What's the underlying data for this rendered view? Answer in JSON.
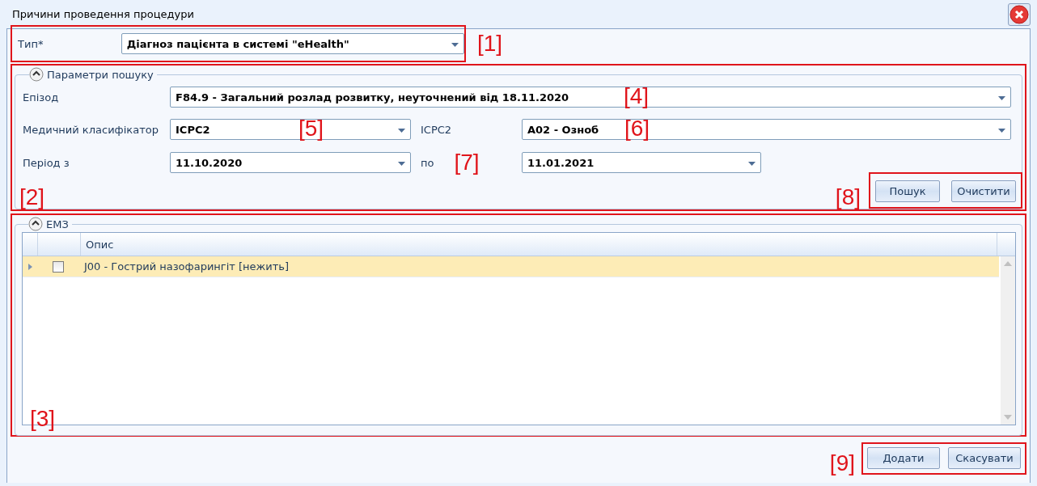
{
  "window": {
    "title": "Причини проведення процедури"
  },
  "type_field": {
    "label": "Тип*",
    "value": "Діагноз пацієнта в системі \"eHealth\"",
    "annotation": "[1]"
  },
  "search_params": {
    "title": "Параметри пошуку",
    "expanded": true,
    "annotation": "[2]",
    "episode": {
      "label": "Епізод",
      "value": "F84.9 - Загальний розлад розвитку, неуточнений від 18.11.2020",
      "annotation": "[4]"
    },
    "classifier": {
      "label": "Медичний класифікатор",
      "value": "ICPC2",
      "annotation": "[5]"
    },
    "code": {
      "label": "ICPC2",
      "value": "A02 - Озноб",
      "annotation": "[6]"
    },
    "period_from": {
      "label": "Період з",
      "value": "11.10.2020"
    },
    "period_to": {
      "label": "по",
      "value": "11.01.2021",
      "annotation": "[7]"
    },
    "buttons": [
      "Пошук",
      "Очистити"
    ],
    "buttons_annotation": "[8]"
  },
  "emz": {
    "title": "ЕМЗ",
    "expanded": true,
    "annotation": "[3]",
    "columns": [
      "Опис"
    ],
    "rows": [
      {
        "text": "J00 - Гострий назофарингіт [нежить]",
        "checked": false,
        "selected": true
      }
    ]
  },
  "footer": {
    "buttons": [
      "Додати",
      "Скасувати"
    ],
    "annotation": "[9]"
  }
}
